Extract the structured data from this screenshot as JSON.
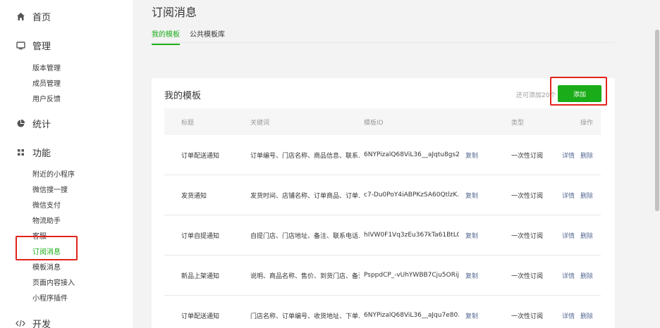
{
  "sidebar": {
    "groups": [
      {
        "label": "首页",
        "icon": "home-icon"
      },
      {
        "label": "管理",
        "icon": "monitor-icon"
      },
      {
        "label": "统计",
        "icon": "pie-chart-icon"
      },
      {
        "label": "功能",
        "icon": "grid-icon"
      },
      {
        "label": "开发",
        "icon": "code-icon"
      }
    ],
    "manage_items": [
      "版本管理",
      "成员管理",
      "用户反馈"
    ],
    "feature_items": [
      "附近的小程序",
      "微信搜一搜",
      "微信支付",
      "物流助手",
      "客服",
      "订阅消息",
      "模板消息",
      "页面内容接入",
      "小程序插件"
    ],
    "active_item": "订阅消息"
  },
  "header": {
    "title": "订阅消息",
    "tabs": [
      {
        "label": "我的模板",
        "active": true
      },
      {
        "label": "公共模板库",
        "active": false
      }
    ]
  },
  "card": {
    "title": "我的模板",
    "remaining": "还可添加20个",
    "add_button": "添加"
  },
  "table": {
    "columns": [
      "标题",
      "关键词",
      "模板ID",
      "类型",
      "操作"
    ],
    "copy_label": "复制",
    "detail_label": "详情",
    "delete_label": "删除",
    "rows": [
      {
        "title": "订单配送通知",
        "keywords": "订单编号、门店名称、商品信息、联系…",
        "id": "6NYPizalQ68ViL36__aJqtu8gs2…",
        "type": "一次性订阅"
      },
      {
        "title": "发货通知",
        "keywords": "发货时间、店铺名称、订单商品、订单…",
        "id": "c7-Du0PoY4iABPKzSA60QtlzK…",
        "type": "一次性订阅"
      },
      {
        "title": "订单自提通知",
        "keywords": "自提门店、门店地址、备注、联系电话…",
        "id": "hIVW0F1Vq3zEu367kTa61BtLO…",
        "type": "一次性订阅"
      },
      {
        "title": "新品上架通知",
        "keywords": "说明、商品名称、售价、到货门店、备注",
        "id": "PsppdCP_-vUhYWBB7Cju5ORij…",
        "type": "一次性订阅"
      },
      {
        "title": "订单配送通知",
        "keywords": "门店名称、订单编号、收货地址、下单…",
        "id": "6NYPizalQ68ViL36__aJqu7e80…",
        "type": "一次性订阅"
      }
    ]
  },
  "colors": {
    "accent": "#1aad19",
    "link": "#576b95",
    "highlight": "#e2231a"
  }
}
